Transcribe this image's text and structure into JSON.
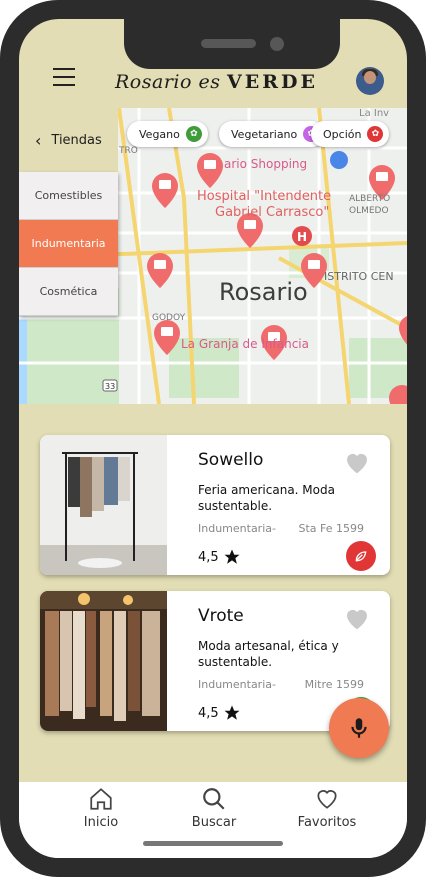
{
  "app": {
    "brand_script": "Rosario es",
    "brand_strong": "VERDE"
  },
  "filters": [
    {
      "label": "Vegano",
      "color": "#3f9c3a",
      "icon": "leaf-icon"
    },
    {
      "label": "Vegetariano",
      "color": "#c564e6",
      "icon": "leaf-icon"
    },
    {
      "label": "Opción",
      "color": "#e03636",
      "icon": "leaf-icon"
    }
  ],
  "categories": {
    "header": "Tiendas",
    "items": [
      "Comestibles",
      "Indumentaria",
      "Cosmética"
    ],
    "active": "Indumentaria",
    "active_color": "#f17a52"
  },
  "map": {
    "city": "Rosario",
    "labels": [
      "La Inv",
      "ario Shopping",
      "Hospital \"Intendente",
      "Gabriel Carrasco\"",
      "ALBERTO",
      "OLMEDO",
      "ISTRITO CEN",
      "GODOY",
      "La Granja de Infancia",
      "TRO",
      "33"
    ]
  },
  "stores": [
    {
      "name": "Sowello",
      "description": "Feria americana. Moda sustentable.",
      "category": "Indumentaria-",
      "address": "Sta Fe 1599",
      "rating": "4,5"
    },
    {
      "name": "Vrote",
      "description": "Moda artesanal, ética y sustentable.",
      "category": "Indumentaria-",
      "address": "Mitre 1599",
      "rating": "4,5"
    }
  ],
  "nav": [
    {
      "label": "Inicio",
      "icon": "home-icon"
    },
    {
      "label": "Buscar",
      "icon": "search-icon"
    },
    {
      "label": "Favoritos",
      "icon": "heart-icon"
    }
  ],
  "colors": {
    "background": "#e2ddb4",
    "accent": "#f07a52",
    "pin": "#f06c6c"
  }
}
